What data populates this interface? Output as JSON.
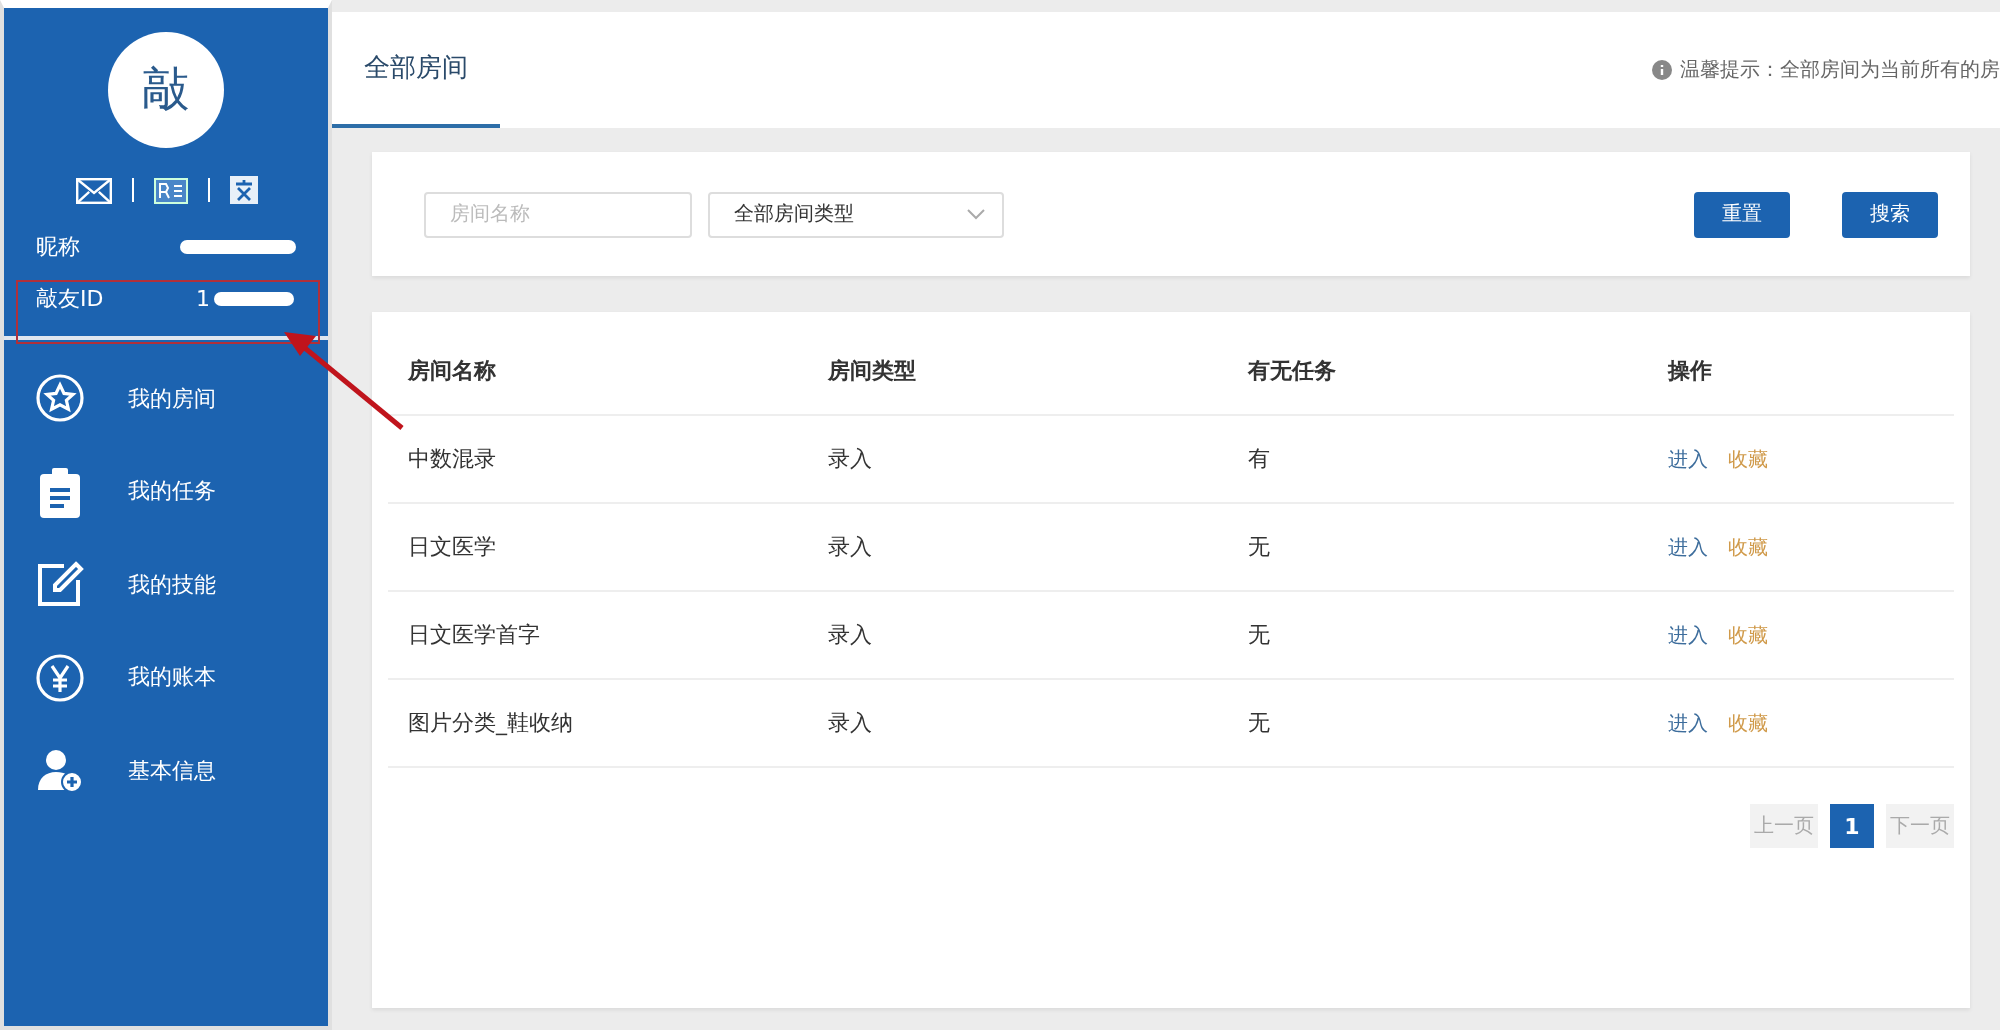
{
  "profile": {
    "avatar_text": "敲",
    "nickname_label": "昵称",
    "id_label": "敲友ID",
    "id_value": "1"
  },
  "menu": [
    {
      "label": "我的房间",
      "kind": "star"
    },
    {
      "label": "我的任务",
      "kind": "clipboard"
    },
    {
      "label": "我的技能",
      "kind": "edit"
    },
    {
      "label": "我的账本",
      "kind": "yen"
    },
    {
      "label": "基本信息",
      "kind": "user"
    }
  ],
  "tabs": [
    {
      "label": "全部房间",
      "selected": true
    }
  ],
  "hint": "温馨提示：全部房间为当前所有的房",
  "filter": {
    "name_placeholder": "房间名称",
    "type_value": "全部房间类型",
    "buttons": [
      "重置",
      "搜索"
    ]
  },
  "table": {
    "columns": [
      "房间名称",
      "房间类型",
      "有无任务",
      "操作"
    ],
    "rows": [
      {
        "name": "中数混录",
        "type": "录入",
        "task": "有",
        "enter": "进入",
        "fav": "收藏"
      },
      {
        "name": "日文医学",
        "type": "录入",
        "task": "无",
        "enter": "进入",
        "fav": "收藏"
      },
      {
        "name": "日文医学首字",
        "type": "录入",
        "task": "无",
        "enter": "进入",
        "fav": "收藏"
      },
      {
        "name": "图片分类_鞋收纳",
        "type": "录入",
        "task": "无",
        "enter": "进入",
        "fav": "收藏"
      }
    ]
  },
  "pagination": {
    "prev": "上一页",
    "pages": [
      {
        "label": "1",
        "selected": true
      }
    ],
    "next": "下一页"
  }
}
